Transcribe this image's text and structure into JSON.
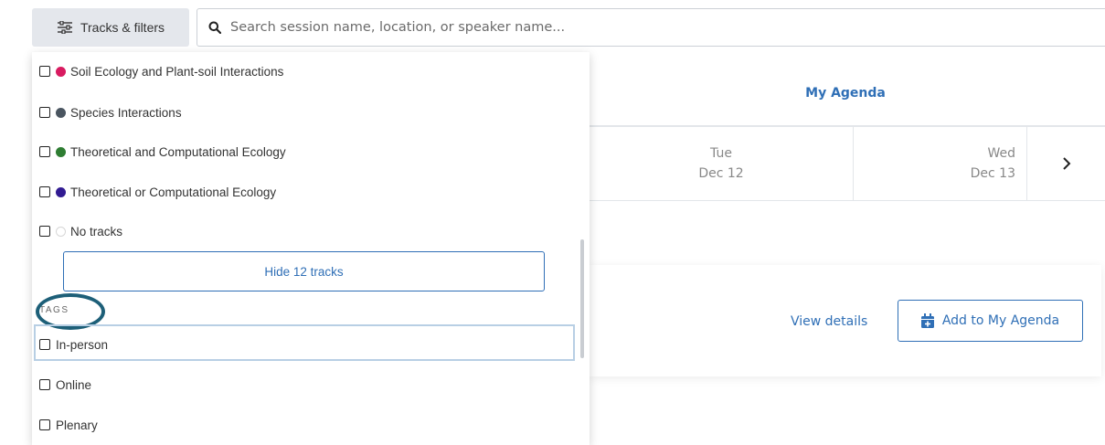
{
  "toolbar": {
    "filter_button_label": "Tracks & filters",
    "search_placeholder": "Search session name, location, or speaker name..."
  },
  "agenda": {
    "tab_label": "My Agenda",
    "days": [
      {
        "dow": "Tue",
        "date": "Dec 12"
      },
      {
        "dow": "Wed",
        "date": "Dec 13"
      }
    ],
    "next_icon": "chevron-right-icon"
  },
  "session": {
    "view_details_label": "View details",
    "add_to_agenda_label": "Add to My Agenda"
  },
  "filters": {
    "tracks": [
      {
        "label": "Soil Ecology and Plant-soil Interactions",
        "color": "#d81b60",
        "checked": false
      },
      {
        "label": "Species Interactions",
        "color": "#4a5560",
        "checked": false
      },
      {
        "label": "Theoretical and Computational Ecology",
        "color": "#2e7d32",
        "checked": false
      },
      {
        "label": "Theoretical or Computational Ecology",
        "color": "#311b92",
        "checked": false
      },
      {
        "label": "No tracks",
        "color": "#ffffff",
        "checked": false
      }
    ],
    "hide_tracks_label": "Hide 12 tracks",
    "tags_heading": "TAGS",
    "tags": [
      {
        "label": "In-person",
        "checked": false
      },
      {
        "label": "Online",
        "checked": false
      },
      {
        "label": "Plenary",
        "checked": false
      }
    ]
  },
  "colors": {
    "accent": "#2f6fb6",
    "highlight": "#1d5f78"
  }
}
